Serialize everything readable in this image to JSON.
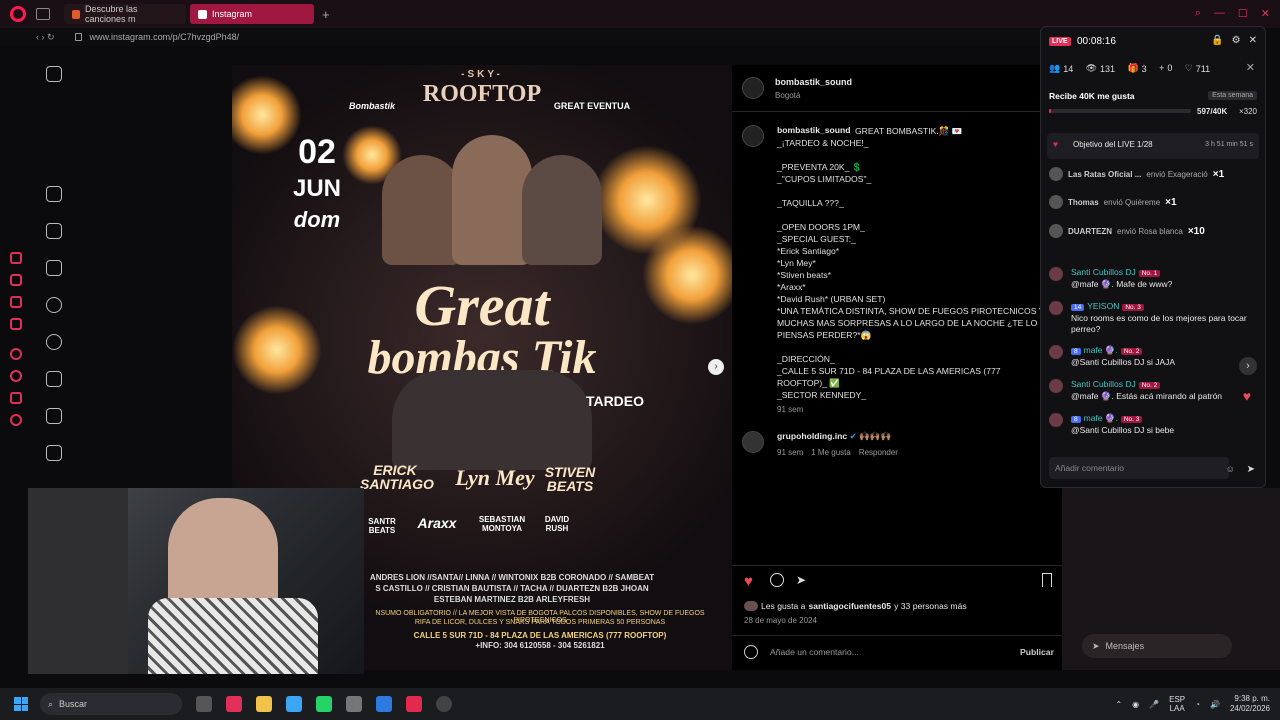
{
  "browser": {
    "tabs": [
      {
        "label": "Descubre las canciones m",
        "favicon_color": "#e05a2b",
        "active": false
      },
      {
        "label": "Instagram",
        "favicon_color": "#e0306a",
        "active": true
      }
    ],
    "url": "www.instagram.com/p/C7hvzgdPh48/"
  },
  "post": {
    "account": "bombastik_sound",
    "location": "Bogotá",
    "caption_account": "bombastik_sound",
    "caption": "GREAT BOMBASTIK.🎊 💌\n_¡TARDEO & NOCHE!_\n\n_PREVENTA 20K_ 💲\n_\"CUPOS LIMITADOS\"_\n\n_TAQUILLA ???_\n\n_OPEN DOORS 1PM_\n_SPECIAL GUEST:_\n*Erick Santiago*\n*Lyn Mey*\n*Stiven beats*\n*Araxx*\n*David Rush* (URBAN SET)\n*UNA TEMÁTICA DISTINTA, SHOW DE FUEGOS PIROTECNICOS Y MUCHAS MAS SORPRESAS A LO LARGO DE LA NOCHE ¿TE LO PIENSAS PERDER?*😱\n\n_DIRECCIÓN_\n_CALLE 5 SUR 71D - 84 PLAZA DE LAS AMERICAS (777 ROOFTOP)_ ✅\n_SECTOR KENNEDY_",
    "caption_time": "91 sem",
    "comment": {
      "account": "grupoholding.inc",
      "text": "🙌🏽🙌🏽🙌🏽",
      "time": "91 sem",
      "likes": "1 Me gusta",
      "reply": "Responder"
    },
    "likes_text": "Les gusta a",
    "likes_user": "santiagocifuentes05",
    "likes_rest": "y 33 personas más",
    "date": "28 de mayo de 2024",
    "add_comment_placeholder": "Añade un comentario...",
    "publish_label": "Publicar"
  },
  "poster": {
    "brand": "-SKY-",
    "title_top": "ROOFTOP",
    "sponsor_left": "Bombastik",
    "sponsor_right": "GREAT EVENTUA",
    "date_day": "02",
    "date_month": "JUN",
    "date_dow": "dom",
    "headline_1": "Great",
    "headline_2": "bombas Tik",
    "tardeo": "TARDEO",
    "guests": [
      "ERICK SANTIAGO",
      "Lyn Mey",
      "STIVEN BEATS"
    ],
    "lineup_row": [
      "SANTR BEATS",
      "Araxx",
      "SEBASTIAN MONTOYA",
      "DAVID RUSH"
    ],
    "djs_line1": "ANDRES LION //SANTA// LINNA // WINTONIX B2B CORONADO // SAMBEAT",
    "djs_line2": "S CASTILLO // CRISTIAN BAUTISTA // TACHA // DUARTEZN B2B JHOAN",
    "djs_line3": "ESTEBAN MARTINEZ B2B ARLEYFRESH",
    "info_line1": "NSUMO OBLIGATORIO // LA MEJOR VISTA DE BOGOTA PALCOS DISPONIBLES, SHOW DE FUEGOS PIROTECNICOS",
    "info_line2": "RIFA DE LICOR, DULCES Y SNAKS PARA TODOS PRIMERAS 50 PERSONAS",
    "address": "CALLE 5 SUR 71D - 84 PLAZA DE LAS AMERICAS (777 ROOFTOP)",
    "phones": "+INFO: 304 6120558 - 304 5261821"
  },
  "live": {
    "badge": "LIVE",
    "timer": "00:08:16",
    "stats": {
      "viewers_a": "14",
      "viewers_b": "131",
      "gifts": "3",
      "follows": "0",
      "likes": "711"
    },
    "goal_title": "Recibe 40K me gusta",
    "goal_week": "Esta semana",
    "goal_progress": "597/40K",
    "goal_fraction": 0.015,
    "goal_reward": "×320",
    "objective": "Objetivo del LIVE 1/28",
    "objective_time": "3 h 51 min 51 s",
    "gifts": [
      {
        "user": "Las Ratas Oficial ...",
        "action": "envió Exageració",
        "count": "×1"
      },
      {
        "user": "Thomas",
        "action": "envió Quiéreme",
        "count": "×1"
      },
      {
        "user": "DUARTEZN",
        "action": "envió Rosa blanca",
        "count": "×10"
      }
    ],
    "chat": [
      {
        "name": "Santi Cubillos DJ",
        "badge": "No. 1",
        "level": "",
        "text": "@mafe 🔮. Mafe de www?"
      },
      {
        "name": "YEISON",
        "badge": "No. 3",
        "level": "14",
        "text": "Nico rooms es como de los mejores para tocar perreo?"
      },
      {
        "name": "mafe 🔮.",
        "badge": "No. 2",
        "level": "8",
        "text": "@Santi Cubillos DJ si JAJA"
      },
      {
        "name": "Santi Cubillos DJ",
        "badge": "No. 2",
        "level": "",
        "text": "@mafe 🔮. Estás acá mirando al patrón"
      },
      {
        "name": "mafe 🔮.",
        "badge": "No. 3",
        "level": "8",
        "text": "@Santi Cubillos DJ si bebe"
      }
    ],
    "comment_placeholder": "Añadir comentario",
    "messages_label": "Mensajes"
  },
  "taskbar": {
    "search": "Buscar",
    "lang_1": "ESP",
    "lang_2": "LAA",
    "time": "9:38 p. m.",
    "date": "24/02/2026"
  },
  "colors": {
    "accent": "#e0305a",
    "ig_blue": "#3897f0",
    "heart": "#ed4956"
  }
}
